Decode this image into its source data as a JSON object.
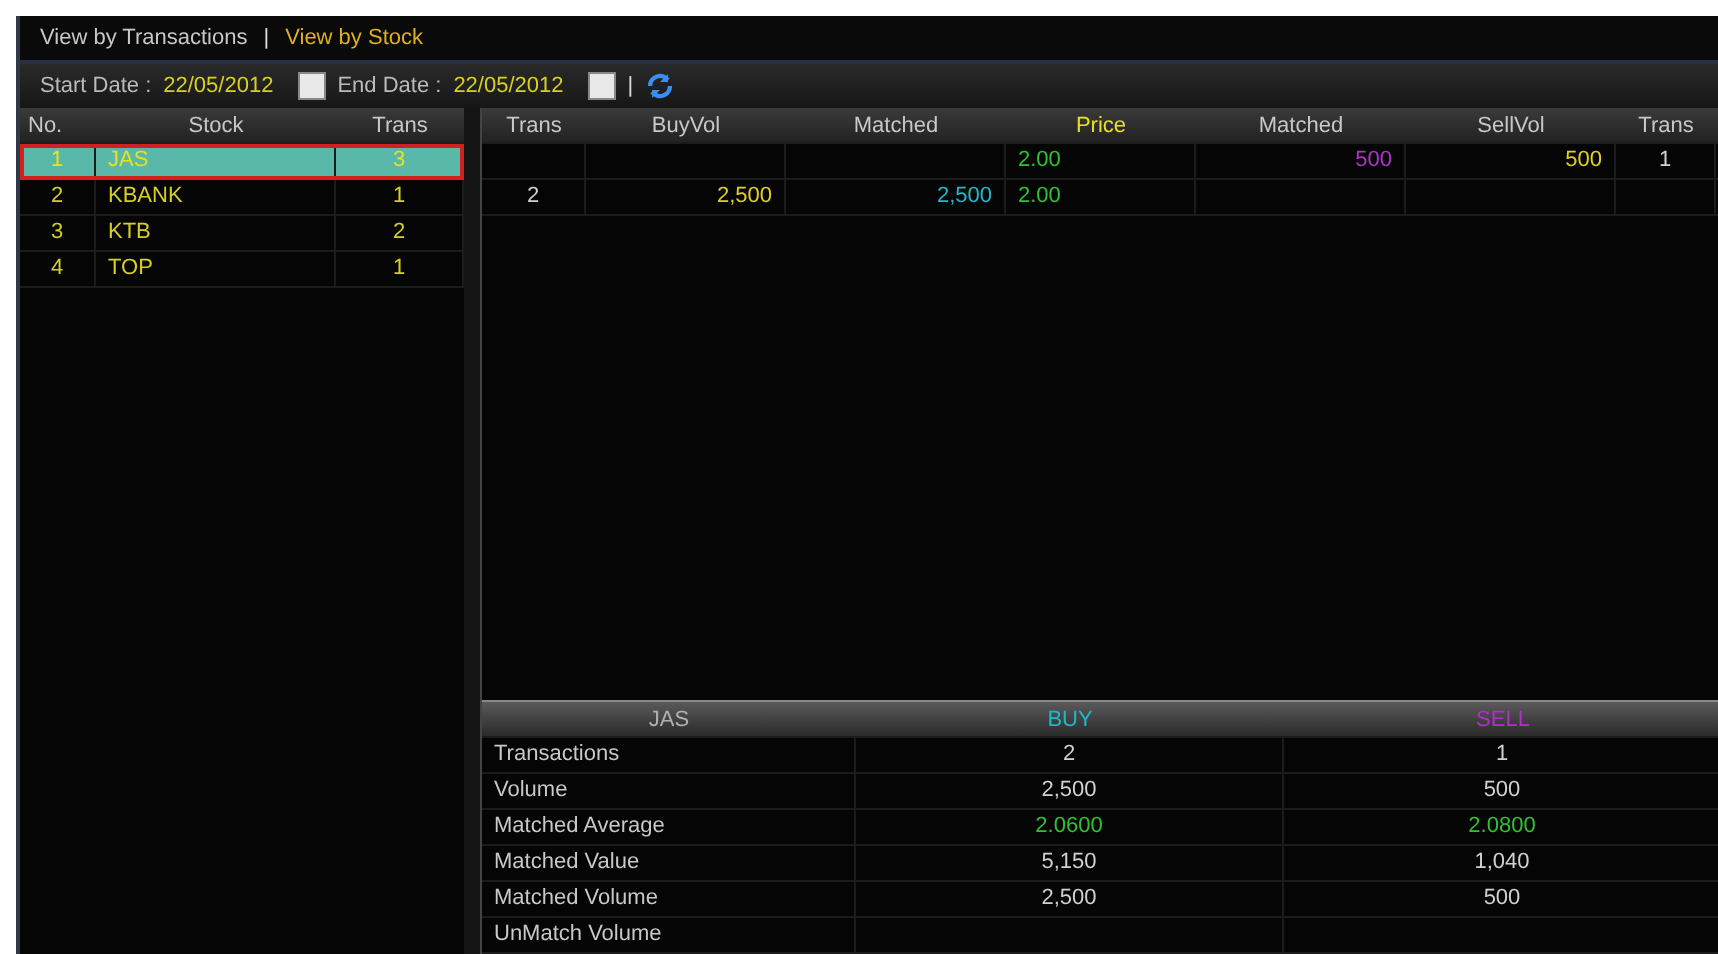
{
  "view_tabs": [
    {
      "label": "View by Transactions",
      "selected": false
    },
    {
      "label": "View by Stock",
      "selected": true
    }
  ],
  "separator": "|",
  "toolbar": {
    "start_label": "Start Date :",
    "start_value": "22/05/2012",
    "end_label": "End Date :",
    "end_value": "22/05/2012"
  },
  "stock_list": {
    "columns": [
      "No.",
      "Stock",
      "Trans"
    ],
    "rows": [
      {
        "no": "1",
        "stock": "JAS",
        "trans": "3",
        "selected": true
      },
      {
        "no": "2",
        "stock": "KBANK",
        "trans": "1",
        "selected": false
      },
      {
        "no": "3",
        "stock": "KTB",
        "trans": "2",
        "selected": false
      },
      {
        "no": "4",
        "stock": "TOP",
        "trans": "1",
        "selected": false
      }
    ]
  },
  "trades": {
    "columns": [
      {
        "label": "Trans",
        "color": "#c8c8c8"
      },
      {
        "label": "BuyVol",
        "color": "#c8c8c8"
      },
      {
        "label": "Matched",
        "color": "#c8c8c8"
      },
      {
        "label": "Price",
        "color": "#e8e020"
      },
      {
        "label": "Matched",
        "color": "#c8c8c8"
      },
      {
        "label": "SellVol",
        "color": "#c8c8c8"
      },
      {
        "label": "Trans",
        "color": "#c8c8c8"
      }
    ],
    "rows": [
      [
        {},
        {},
        {},
        {
          "text": "2.00",
          "color": "#30c030"
        },
        {
          "text": "500",
          "color": "#b030c8"
        },
        {
          "text": "500",
          "color": "#e0d020"
        },
        {
          "text": "1",
          "color": "#d0d0d0"
        }
      ],
      [
        {
          "text": "2",
          "color": "#d0d0d0"
        },
        {
          "text": "2,500",
          "color": "#e0d020"
        },
        {
          "text": "2,500",
          "color": "#20b8c8"
        },
        {
          "text": "2.00",
          "color": "#30c030"
        },
        {},
        {},
        {}
      ]
    ]
  },
  "summary": {
    "headers": [
      {
        "label": "JAS",
        "color": "#b0b0b0"
      },
      {
        "label": "BUY",
        "color": "#20b8c8"
      },
      {
        "label": "SELL",
        "color": "#b030c8"
      }
    ],
    "rows": [
      {
        "label": "Transactions",
        "buy": {
          "text": "2",
          "color": "#d0d0d0"
        },
        "sell": {
          "text": "1",
          "color": "#d0d0d0"
        }
      },
      {
        "label": "Volume",
        "buy": {
          "text": "2,500",
          "color": "#d0d0d0"
        },
        "sell": {
          "text": "500",
          "color": "#d0d0d0"
        }
      },
      {
        "label": "Matched Average",
        "buy": {
          "text": "2.0600",
          "color": "#30c030"
        },
        "sell": {
          "text": "2.0800",
          "color": "#30c030"
        }
      },
      {
        "label": "Matched Value",
        "buy": {
          "text": "5,150",
          "color": "#d0d0d0"
        },
        "sell": {
          "text": "1,040",
          "color": "#d0d0d0"
        }
      },
      {
        "label": "Matched Volume",
        "buy": {
          "text": "2,500",
          "color": "#d0d0d0"
        },
        "sell": {
          "text": "500",
          "color": "#d0d0d0"
        }
      },
      {
        "label": "UnMatch Volume"
      }
    ]
  }
}
